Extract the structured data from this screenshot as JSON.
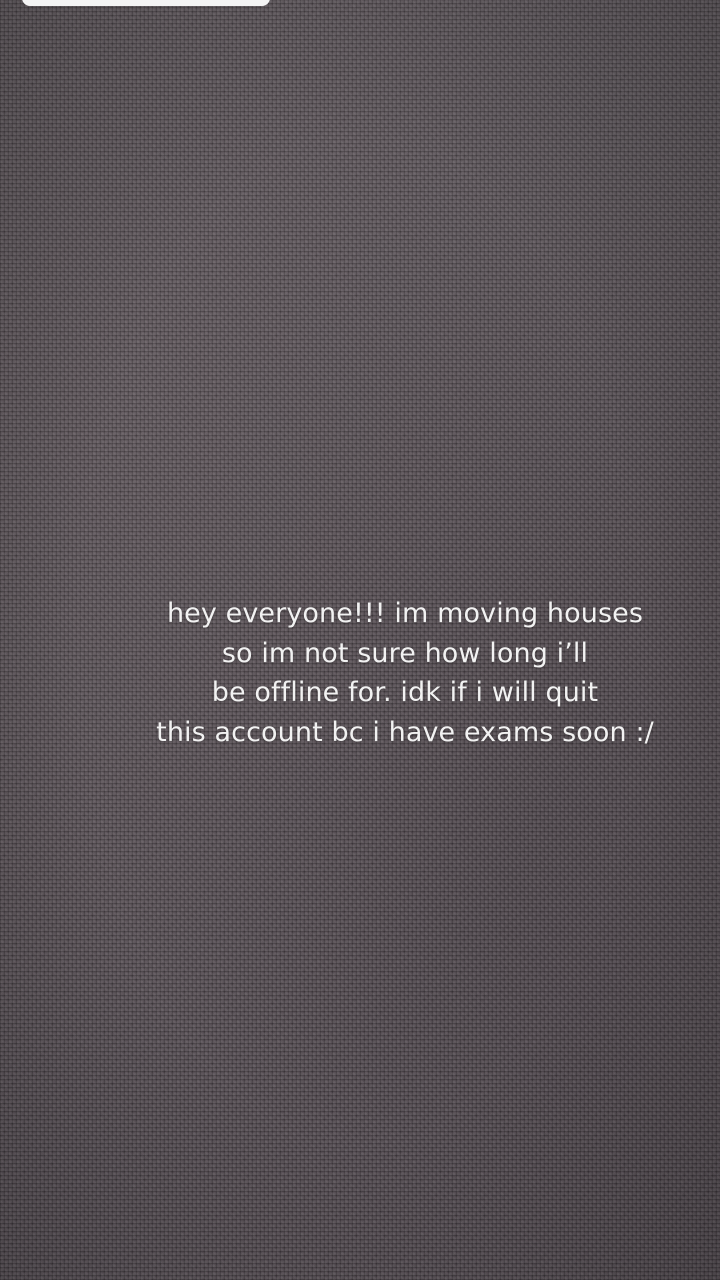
{
  "caption": {
    "lines": [
      "hey everyone!!! im moving houses",
      "so im not sure how long i’ll",
      "be offline for. idk if i will quit",
      "this account bc i have exams soon :/"
    ],
    "color": "#f2f2f2"
  },
  "background": {
    "description_color": "#5a5257"
  }
}
